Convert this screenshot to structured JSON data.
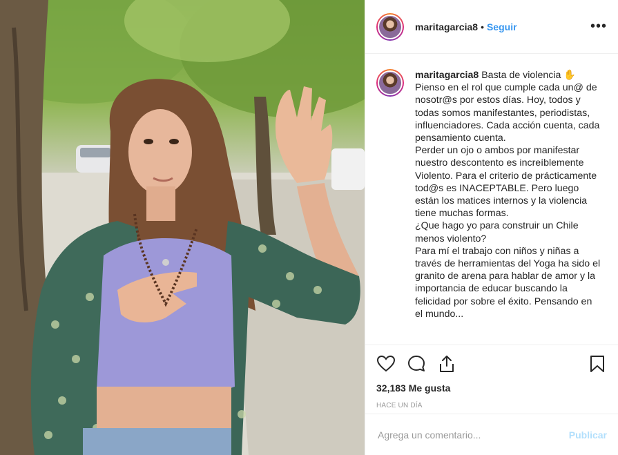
{
  "post": {
    "username": "maritagarcia8",
    "dot": "•",
    "follow_label": "Seguir",
    "more_icon": "more-options-icon"
  },
  "caption": {
    "username": "maritagarcia8",
    "text": " Basta de violencia ✋\nPienso en el rol que cumple cada un@ de nosotr@s por estos días. Hoy, todos y todas somos manifestantes, periodistas, influenciadores. Cada acción cuenta, cada pensamiento cuenta.\nPerder un ojo o ambos por manifestar nuestro descontento es increíblemente Violento. Para el criterio de prácticamente tod@s es INACEPTABLE. Pero luego están los matices internos y la violencia tiene muchas formas.\n¿Que hago yo para construir un Chile menos violento?\nPara mí el trabajo con niños y niñas a través de herramientas del Yoga ha sido el granito de arena para hablar de amor y la importancia de educar buscando la felicidad por sobre el éxito. Pensando en el mundo..."
  },
  "actions": {
    "icons": [
      "heart-icon",
      "comment-icon",
      "share-icon",
      "bookmark-icon"
    ]
  },
  "stats": {
    "likes": "32,183 Me gusta",
    "time": "HACE UN DÍA"
  },
  "comment_box": {
    "placeholder": "Agrega un comentario...",
    "publish_label": "Publicar"
  },
  "colors": {
    "link": "#3897f0",
    "publish_disabled": "#b2dffc",
    "muted": "#999999"
  }
}
